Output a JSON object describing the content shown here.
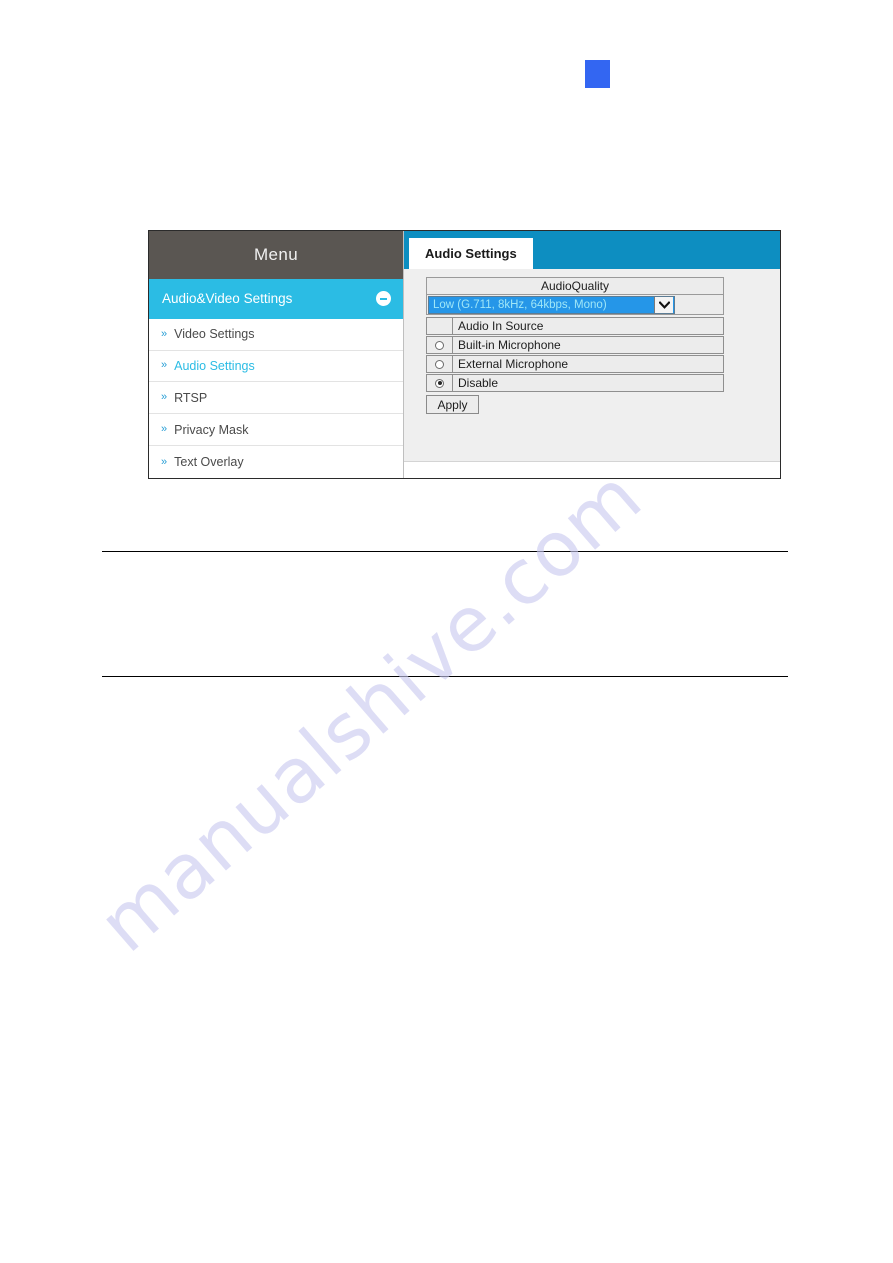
{
  "figure": {
    "sidebar": {
      "header_label": "Menu",
      "group": {
        "label": "Audio&Video Settings",
        "collapse_icon": "minus-circle-icon"
      },
      "items": [
        {
          "label": "Video Settings",
          "chevron": "»",
          "active": false
        },
        {
          "label": "Audio Settings",
          "chevron": "»",
          "active": true
        },
        {
          "label": "RTSP",
          "chevron": "»",
          "active": false
        },
        {
          "label": "Privacy Mask",
          "chevron": "»",
          "active": false
        },
        {
          "label": "Text Overlay",
          "chevron": "»",
          "active": false
        }
      ]
    },
    "content": {
      "active_tab": "Audio Settings",
      "audio_quality": {
        "header": "AudioQuality",
        "selected_value": "Low (G.711, 8kHz, 64kbps, Mono)",
        "dropdown_icon": "chevron-down-icon"
      },
      "audio_in_source": {
        "header": "Audio In Source",
        "options": [
          {
            "label": "Built-in Microphone",
            "selected": false
          },
          {
            "label": "External Microphone",
            "selected": false
          },
          {
            "label": "Disable",
            "selected": true
          }
        ]
      },
      "apply_label": "Apply"
    }
  },
  "watermark": {
    "text": "manualshive.com"
  },
  "colors": {
    "accent_cyan": "#2bbce4",
    "tabbar_blue": "#0d8ec1",
    "menu_header_gray": "#5a5652",
    "select_highlight": "#2596e8",
    "marker_blue": "#3366f2"
  }
}
